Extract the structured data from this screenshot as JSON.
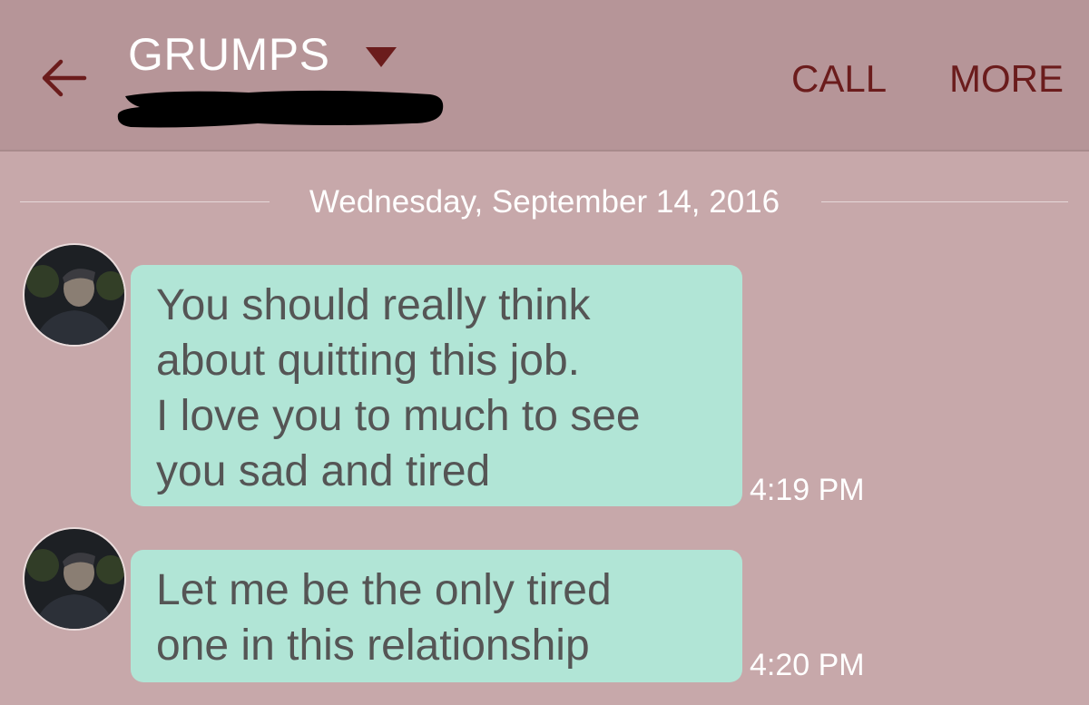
{
  "header": {
    "title": "GRUMPS",
    "back_icon": "arrow-left-icon",
    "dropdown_icon": "triangle-down-icon",
    "actions": {
      "call": "CALL",
      "more": "MORE"
    }
  },
  "date_separator": "Wednesday, September 14, 2016",
  "messages": [
    {
      "text": "You should really think\nabout quitting this job.\nI love you to much to see\nyou sad and tired",
      "time": "4:19 PM"
    },
    {
      "text": "Let me be the only tired\none in this relationship",
      "time": "4:20 PM"
    }
  ],
  "colors": {
    "background": "#c7a8aa",
    "header": "#b69598",
    "bubble": "#b1e5d6",
    "accent": "#6b1c1c"
  }
}
